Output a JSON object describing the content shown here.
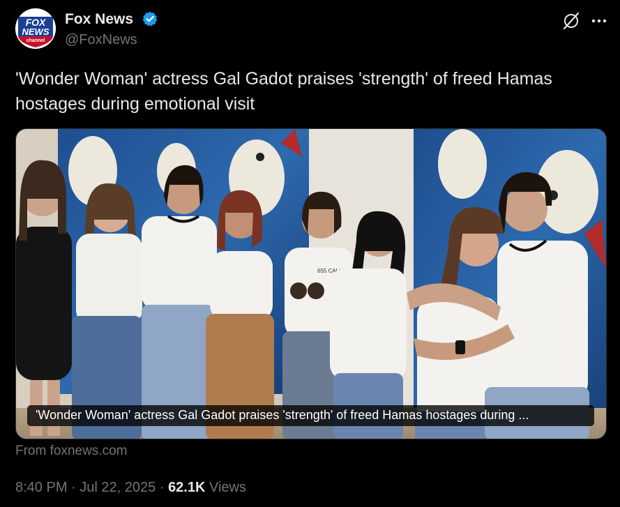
{
  "author": {
    "name": "Fox News",
    "handle": "@FoxNews",
    "verified": true,
    "avatar_icon": "fox-news-logo",
    "avatar_text_top": "FOX",
    "avatar_text_mid": "NEWS",
    "avatar_text_bottom": "channel"
  },
  "tweet": {
    "text": "'Wonder Woman' actress Gal Gadot praises 'strength' of freed Hamas hostages during emotional visit"
  },
  "media": {
    "caption": "'Wonder Woman' actress Gal Gadot praises 'strength' of freed Hamas hostages during ...",
    "shirt_text": "655 CALI & ZIV"
  },
  "source": "From foxnews.com",
  "meta": {
    "time": "8:40 PM",
    "separator": "·",
    "date": "Jul 22, 2025",
    "views_count": "62.1K",
    "views_label": "Views"
  },
  "icons": {
    "grok": "grok-icon",
    "more": "more-icon",
    "verified": "verified-badge-icon"
  },
  "colors": {
    "background": "#000000",
    "text": "#e7e9ea",
    "muted": "#71767b",
    "verified": "#1d9bf0",
    "fox_blue": "#1c3f94",
    "fox_red": "#c8102e"
  }
}
